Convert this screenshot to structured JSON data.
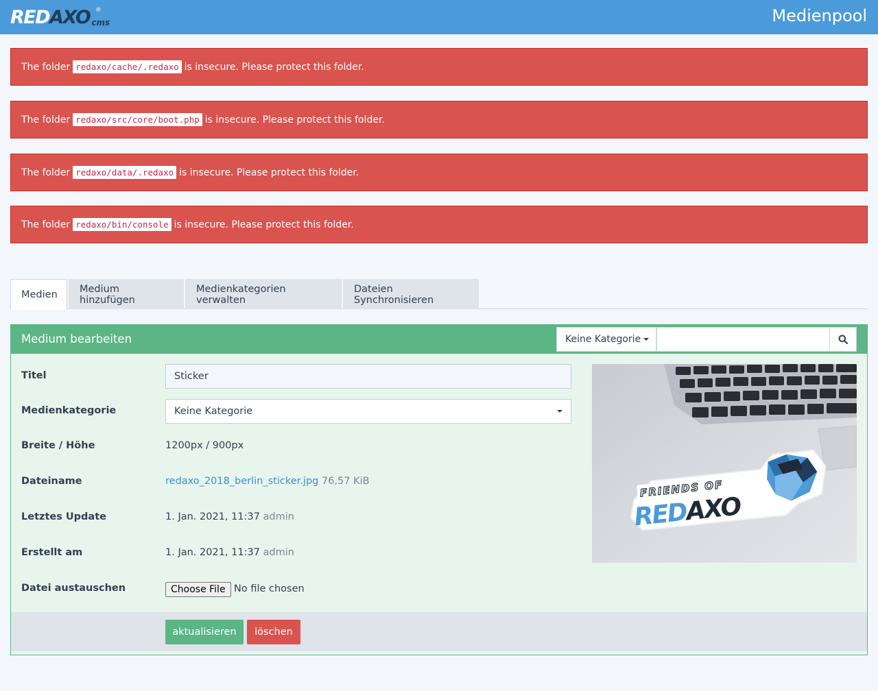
{
  "app": {
    "logo_main": "RED",
    "logo_accent": "AXO",
    "logo_reg": "®",
    "logo_sub": "cms",
    "page_title": "Medienpool"
  },
  "alerts": [
    {
      "prefix": "The folder",
      "path": "redaxo/cache/.redaxo",
      "suffix": "is insecure. Please protect this folder."
    },
    {
      "prefix": "The folder",
      "path": "redaxo/src/core/boot.php",
      "suffix": "is insecure. Please protect this folder."
    },
    {
      "prefix": "The folder",
      "path": "redaxo/data/.redaxo",
      "suffix": "is insecure. Please protect this folder."
    },
    {
      "prefix": "The folder",
      "path": "redaxo/bin/console",
      "suffix": "is insecure. Please protect this folder."
    }
  ],
  "tabs": [
    {
      "label": "Medien",
      "active": true
    },
    {
      "label": "Medium hinzufügen"
    },
    {
      "label": "Medienkategorien verwalten"
    },
    {
      "label": "Dateien Synchronisieren"
    }
  ],
  "panel": {
    "title": "Medium bearbeiten",
    "category_filter": "Keine Kategorie",
    "search_value": ""
  },
  "form": {
    "title_label": "Titel",
    "title_value": "Sticker",
    "category_label": "Medienkategorie",
    "category_value": "Keine Kategorie",
    "size_label": "Breite / Höhe",
    "size_value": "1200px / 900px",
    "filename_label": "Dateiname",
    "filename_value": "redaxo_2018_berlin_sticker.jpg",
    "filesize_value": "76,57 KiB",
    "updated_label": "Letztes Update",
    "updated_value": "1. Jan. 2021, 11:37",
    "updated_user": "admin",
    "created_label": "Erstellt am",
    "created_value": "1. Jan. 2021, 11:37",
    "created_user": "admin",
    "replace_label": "Datei austauschen",
    "choose_file_label": "Choose File",
    "no_file_text": "No file chosen"
  },
  "preview": {
    "sticker_top": "FRIENDS OF",
    "sticker_red": "RED",
    "sticker_axo": "AXO"
  },
  "actions": {
    "save_label": "aktualisieren",
    "delete_label": "löschen"
  },
  "colors": {
    "header": "#4b9ad9",
    "alert": "#d9534f",
    "success": "#5bb585",
    "link": "#3f8ed0"
  }
}
